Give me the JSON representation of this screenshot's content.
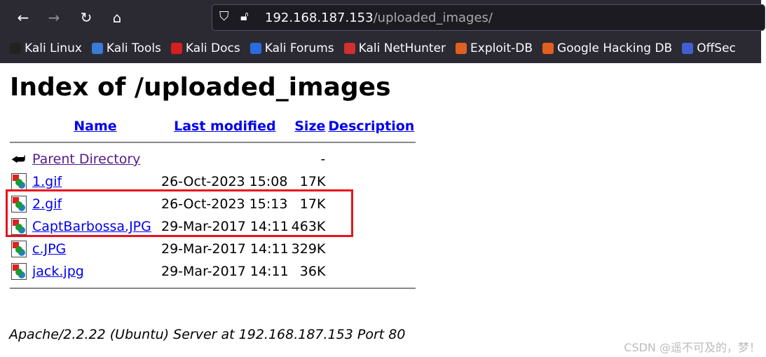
{
  "browser": {
    "url_host": "192.168.187.153",
    "url_path": "/uploaded_images/",
    "bookmarks": [
      "Kali Linux",
      "Kali Tools",
      "Kali Docs",
      "Kali Forums",
      "Kali NetHunter",
      "Exploit-DB",
      "Google Hacking DB",
      "OffSec"
    ],
    "bookmark_colors": [
      "#222",
      "#3a7bd5",
      "#d42020",
      "#2a6be0",
      "#d03030",
      "#e06020",
      "#e06020",
      "#4060d0"
    ]
  },
  "page": {
    "title": "Index of /uploaded_images",
    "columns": [
      "Name",
      "Last modified",
      "Size",
      "Description"
    ],
    "parent": {
      "name": "Parent Directory",
      "size": "-"
    },
    "rows": [
      {
        "name": "1.gif",
        "modified": "26-Oct-2023 15:08",
        "size": "17K"
      },
      {
        "name": "2.gif",
        "modified": "26-Oct-2023 15:13",
        "size": "17K"
      },
      {
        "name": "CaptBarbossa.JPG",
        "modified": "29-Mar-2017 14:11",
        "size": "463K"
      },
      {
        "name": "c.JPG",
        "modified": "29-Mar-2017 14:11",
        "size": "329K"
      },
      {
        "name": "jack.jpg",
        "modified": "29-Mar-2017 14:11",
        "size": "36K"
      }
    ],
    "footer": "Apache/2.2.22 (Ubuntu) Server at 192.168.187.153 Port 80"
  },
  "highlight_color": "#e8141e",
  "watermark": "CSDN @遥不可及的，梦！"
}
